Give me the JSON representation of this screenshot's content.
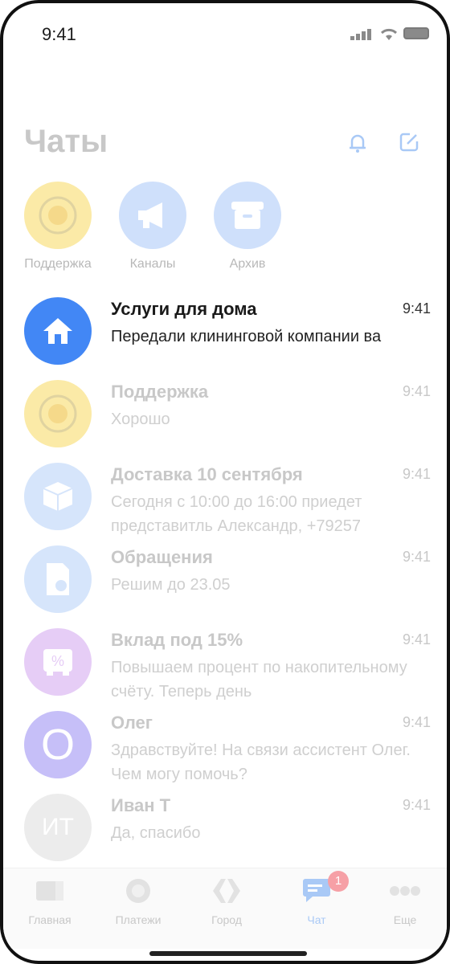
{
  "status_bar": {
    "time": "9:41"
  },
  "header": {
    "title": "Чаты",
    "bell_icon": "bell-icon",
    "compose_icon": "compose-icon"
  },
  "quick_access": [
    {
      "label": "Поддержка",
      "icon": "coin-emblem-icon",
      "color": "#fbeaa7"
    },
    {
      "label": "Каналы",
      "icon": "megaphone-icon",
      "color": "#cfe0fb"
    },
    {
      "label": "Архив",
      "icon": "archive-box-icon",
      "color": "#cfe0fb"
    }
  ],
  "chats": [
    {
      "title": "Услуги для дома",
      "time": "9:41",
      "message": "Передали клининговой компании ва",
      "icon": "house-icon",
      "color": "#4287f5"
    },
    {
      "title": "Поддержка",
      "time": "9:41",
      "message": "Хорошо",
      "icon": "coin-emblem-icon",
      "color": "#fbeaa7"
    },
    {
      "title": "Доставка 10 сентября",
      "time": "9:41",
      "message": "Сегодня с 10:00 до 16:00 приедет представитль Александр, +79257",
      "icon": "package-icon",
      "color": "#d6e5fb"
    },
    {
      "title": "Обращения",
      "time": "9:41",
      "message": "Решим до 23.05",
      "icon": "document-clock-icon",
      "color": "#d6e5fb"
    },
    {
      "title": "Вклад под 15%",
      "time": "9:41",
      "message": "Повышаем процент по накопительному счёту. Теперь день",
      "icon": "percent-safe-icon",
      "color": "#e6cdf6"
    },
    {
      "title": "Олег",
      "time": "9:41",
      "message": "Здравствуйте! На связи ассистент Олег. Чем могу помочь?",
      "avatar_text": "O",
      "color": "#c6bff8"
    },
    {
      "title": "Иван Т",
      "time": "9:41",
      "message": "Да, спасибо",
      "avatar_text": "ИТ",
      "color": "#ececec"
    }
  ],
  "tabbar": [
    {
      "label": "Главная",
      "icon": "card-icon"
    },
    {
      "label": "Платежи",
      "icon": "payments-circle-icon"
    },
    {
      "label": "Город",
      "icon": "city-diamond-icon"
    },
    {
      "label": "Чат",
      "icon": "chat-bubble-icon",
      "badge": "1",
      "active": true
    },
    {
      "label": "Еще",
      "icon": "more-dots-icon"
    }
  ],
  "colors": {
    "accent": "#4287f5",
    "badge": "#f6a0a6"
  }
}
